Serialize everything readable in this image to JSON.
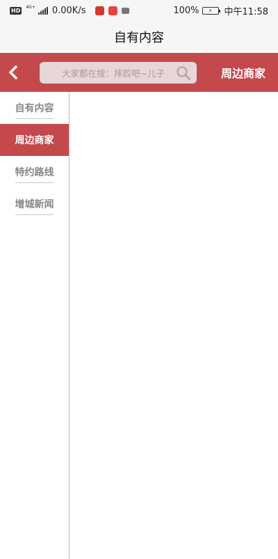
{
  "status_bar": {
    "hd": "HD",
    "network": "4G+",
    "speed": "0.00K/s",
    "battery_pct": "100%",
    "time": "中午11:58"
  },
  "title_bar": {
    "title": "自有内容"
  },
  "header": {
    "back_icon": "chevron-left-icon",
    "search_placeholder": "大家都在搜：摔跤吧~儿子",
    "search_icon": "search-icon",
    "title": "周边商家"
  },
  "sidebar": {
    "items": [
      {
        "label": "自有内容",
        "active": false
      },
      {
        "label": "周边商家",
        "active": true
      },
      {
        "label": "特约路线",
        "active": false
      },
      {
        "label": "增城新闻",
        "active": false
      }
    ]
  },
  "colors": {
    "accent": "#c4494c",
    "search_bg": "#e8d7d7"
  }
}
